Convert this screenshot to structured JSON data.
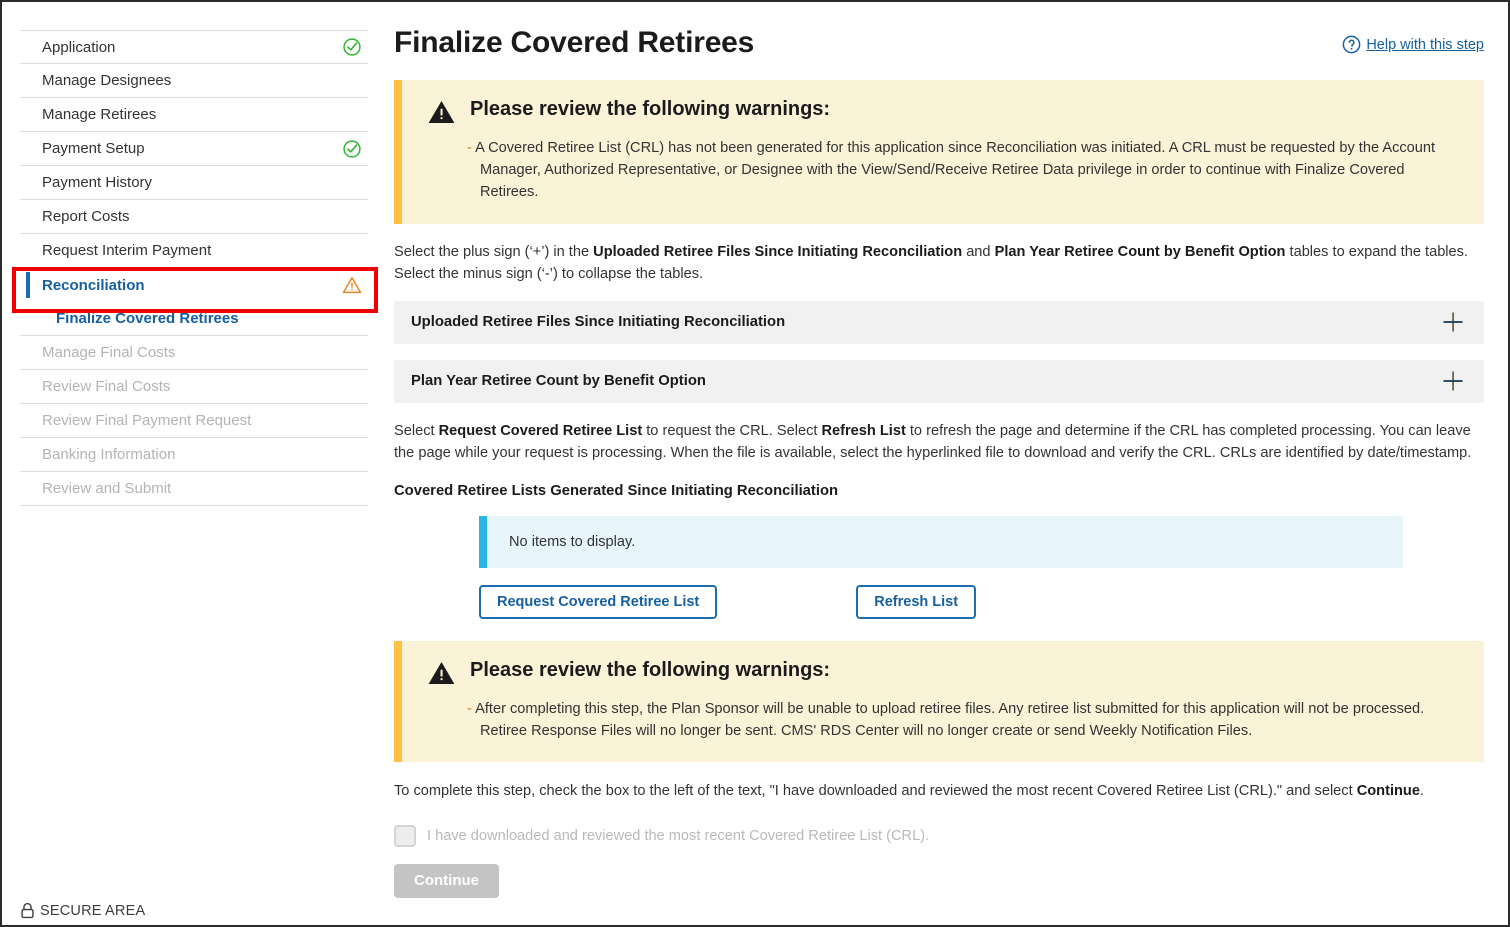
{
  "sidebar": {
    "items": [
      {
        "label": "Application",
        "state": "complete",
        "icon": "check-circle-icon"
      },
      {
        "label": "Manage Designees",
        "state": "normal",
        "icon": ""
      },
      {
        "label": "Manage Retirees",
        "state": "normal",
        "icon": ""
      },
      {
        "label": "Payment Setup",
        "state": "complete",
        "icon": "check-circle-icon"
      },
      {
        "label": "Payment History",
        "state": "normal",
        "icon": ""
      },
      {
        "label": "Report Costs",
        "state": "normal",
        "icon": ""
      },
      {
        "label": "Request Interim Payment",
        "state": "normal",
        "icon": ""
      },
      {
        "label": "Reconciliation",
        "state": "active",
        "icon": "warning-triangle-icon"
      },
      {
        "label": "Finalize Covered Retirees",
        "state": "sub",
        "icon": ""
      },
      {
        "label": "Manage Final Costs",
        "state": "disabled",
        "icon": ""
      },
      {
        "label": "Review Final Costs",
        "state": "disabled",
        "icon": ""
      },
      {
        "label": "Review Final Payment Request",
        "state": "disabled",
        "icon": ""
      },
      {
        "label": "Banking Information",
        "state": "disabled",
        "icon": ""
      },
      {
        "label": "Review and Submit",
        "state": "disabled",
        "icon": ""
      }
    ],
    "secure_area_label": "SECURE AREA",
    "highlight_color": "#f10000"
  },
  "header": {
    "title": "Finalize Covered Retirees",
    "help_link_label": "Help with this step"
  },
  "warning_top": {
    "title": "Please review the following warnings:",
    "bullet_marker": "-",
    "text": "A Covered Retiree List (CRL) has not been generated for this application since Reconciliation was initiated. A CRL must be requested by the Account Manager, Authorized Representative, or Designee with the View/Send/Receive Retiree Data privilege in order to continue with Finalize Covered Retirees."
  },
  "instructions": {
    "expand_text_1": "Select the plus sign (‘+’) in the ",
    "bold_1": "Uploaded Retiree Files Since Initiating Reconciliation",
    "expand_text_2": " and ",
    "bold_2": "Plan Year Retiree Count by Benefit Option",
    "expand_text_3": " tables to expand the tables. Select the minus sign (‘-’) to collapse the tables.",
    "request_text_1": "Select ",
    "request_bold_1": "Request Covered Retiree List",
    "request_text_2": " to request the CRL. Select ",
    "request_bold_2": "Refresh List",
    "request_text_3": " to refresh the page and determine if the CRL has completed processing. You can leave the page while your request is processing. When the file is available, select the hyperlinked file to download and verify the CRL. CRLs are identified by date/timestamp."
  },
  "accordions": [
    {
      "title": "Uploaded Retiree Files Since Initiating Reconciliation",
      "toggle": "+",
      "expanded": false
    },
    {
      "title": "Plan Year Retiree Count by Benefit Option",
      "toggle": "+",
      "expanded": false
    }
  ],
  "crl_section": {
    "heading": "Covered Retiree Lists Generated Since Initiating Reconciliation",
    "empty_message": "No items to display.",
    "request_button": "Request Covered Retiree List",
    "refresh_button": "Refresh List"
  },
  "warning_bottom": {
    "title": "Please review the following warnings:",
    "bullet_marker": "-",
    "text": "After completing this step, the Plan Sponsor will be unable to upload retiree files. Any retiree list submitted for this application will not be processed. Retiree Response Files will no longer be sent. CMS' RDS Center will no longer create or send Weekly Notification Files."
  },
  "complete_step": {
    "text_1": "To complete this step, check the box to the left of the text, \"I have downloaded and reviewed the most recent Covered Retiree List (CRL).\" and select ",
    "bold_1": "Continue",
    "text_2": ".",
    "checkbox_label": "I have downloaded and reviewed the most recent Covered Retiree List (CRL).",
    "checkbox_checked": false,
    "continue_button": "Continue",
    "continue_disabled": true
  },
  "colors": {
    "link_blue": "#16609e",
    "accent_blue": "#1d6eb0",
    "warning_bg": "#faf3d8",
    "warning_border": "#ffc043",
    "info_bg": "#e8f6fb",
    "info_border": "#29b8e5",
    "success_green": "#28a745",
    "warning_orange": "#e8861e",
    "highlight_red": "#f10000",
    "disabled_gray": "#c4c4c4"
  }
}
